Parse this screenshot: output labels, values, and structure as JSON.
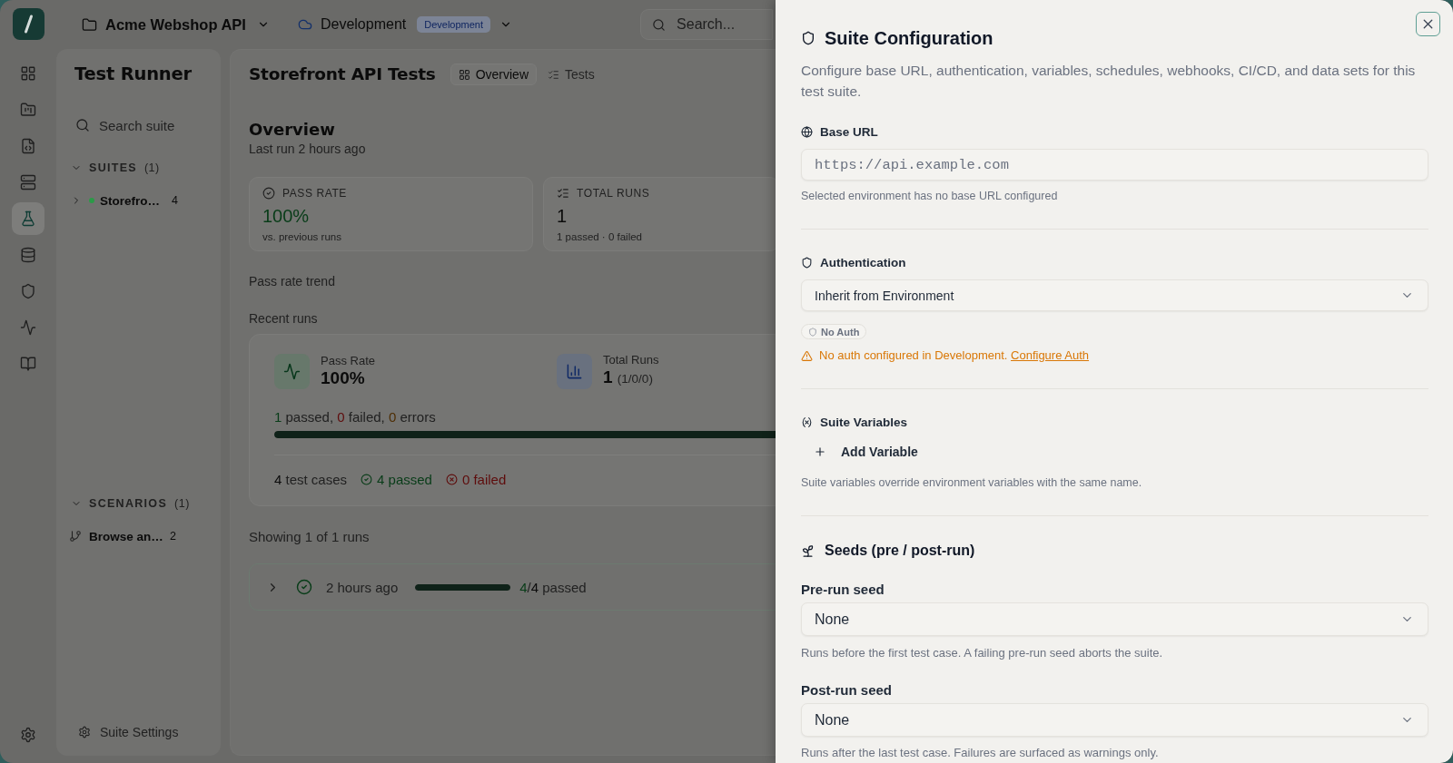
{
  "rail": [
    {
      "selected": false
    },
    {
      "selected": false
    },
    {
      "selected": false
    },
    {
      "selected": false
    },
    {
      "selected": true
    },
    {
      "selected": false
    },
    {
      "selected": false
    },
    {
      "selected": false
    },
    {
      "selected": false
    }
  ],
  "header": {
    "project": "Acme Webshop API",
    "environment": {
      "name": "Development",
      "badge": "Development"
    },
    "search": {
      "placeholder": "Search..."
    }
  },
  "sidebar": {
    "title": "Test Runner",
    "search": {
      "placeholder": "Search suite"
    },
    "sections": [
      {
        "label": "SUITES",
        "count": "(1)",
        "expanded": true,
        "items": [
          {
            "kind": "suite",
            "name": "Storefro…",
            "count": "4",
            "color": "#2b9a48",
            "expanded": false
          }
        ]
      },
      {
        "label": "SCENARIOS",
        "count": "(1)",
        "expanded": true,
        "items": [
          {
            "kind": "scenario",
            "name": "Browse an…",
            "count": "2"
          }
        ]
      }
    ],
    "footer": "Suite Settings"
  },
  "main": {
    "title": "Storefront API Tests",
    "tabs": [
      {
        "label": "Overview",
        "selected": true
      },
      {
        "label": "Tests",
        "selected": false
      }
    ],
    "heading": "Overview",
    "subheading": "Last run 2 hours ago",
    "stat_cards": [
      {
        "kind": "pass_rate",
        "label": "PASS RATE",
        "value": "100%",
        "note": "vs. previous runs"
      },
      {
        "kind": "total_runs",
        "label": "TOTAL RUNS",
        "value": "1",
        "note": "1 passed · 0 failed"
      }
    ],
    "trend_label": "Pass rate trend",
    "recent": {
      "label": "Recent runs",
      "metrics": [
        {
          "kind": "pass_rate",
          "label": "Pass Rate",
          "value": "100%"
        },
        {
          "kind": "total_runs",
          "label": "Total Runs",
          "value": "1",
          "detail": "(1/0/0)"
        }
      ],
      "breakdown": [
        {
          "kind": "passed",
          "count": "1",
          "label": "passed,"
        },
        {
          "kind": "failed",
          "count": "0",
          "label": "failed,"
        },
        {
          "kind": "error",
          "count": "0",
          "label": "errors"
        }
      ],
      "level": 1,
      "cases": {
        "total": "4",
        "label": "test cases",
        "passed": "4 passed",
        "failed": "0 failed"
      }
    },
    "runs_caption": "Showing 1 of 1 runs",
    "runs": [
      {
        "kind": "passed",
        "expanded": false,
        "time": "2 hours ago",
        "level": 1,
        "passed": "4",
        "separator": "/",
        "total": "4",
        "label": "passed"
      }
    ]
  },
  "drawer": {
    "title": "Suite Configuration",
    "description": "Configure base URL, authentication, variables, schedules, webhooks, CI/CD, and data sets for this test suite.",
    "sections": [
      {
        "kind": "base_url",
        "label": "Base URL",
        "input": {
          "placeholder": "https://api.example.com"
        },
        "helper": "Selected environment has no base URL configured"
      },
      {
        "kind": "auth",
        "label": "Authentication",
        "select": {
          "value": "Inherit from Environment"
        },
        "badge": "No Auth",
        "warning": {
          "text": "No auth configured in Development.",
          "link": "Configure Auth"
        }
      },
      {
        "kind": "variables",
        "label": "Suite Variables",
        "button": "Add Variable",
        "helper": "Suite variables override environment variables with the same name."
      },
      {
        "kind": "seeds",
        "label": "Seeds (pre / post-run)",
        "fields": [
          {
            "label": "Pre-run seed",
            "value": "None",
            "helper": "Runs before the first test case. A failing pre-run seed aborts the suite."
          },
          {
            "label": "Post-run seed",
            "value": "None",
            "helper": "Runs after the last test case. Failures are surfaced as warnings only."
          }
        ]
      }
    ]
  }
}
